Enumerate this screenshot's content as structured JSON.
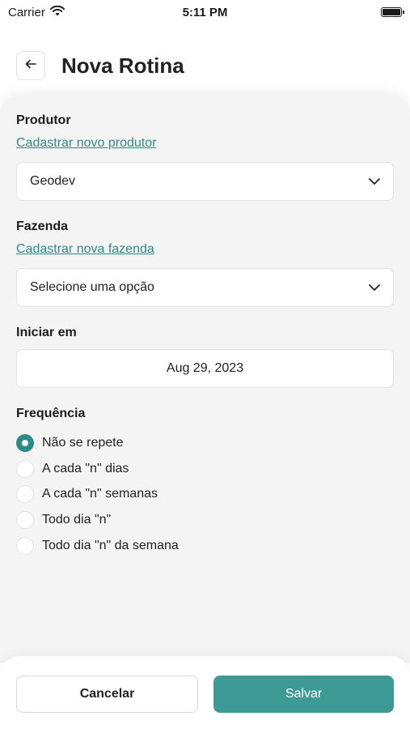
{
  "status_bar": {
    "carrier": "Carrier",
    "time": "5:11 PM"
  },
  "header": {
    "title": "Nova Rotina"
  },
  "form": {
    "produtor": {
      "label": "Produtor",
      "link": "Cadastrar novo produtor",
      "selected": "Geodev"
    },
    "fazenda": {
      "label": "Fazenda",
      "link": "Cadastrar nova fazenda",
      "placeholder": "Selecione uma opção"
    },
    "iniciar_em": {
      "label": "Iniciar em",
      "date": "Aug 29, 2023"
    },
    "frequencia": {
      "label": "Frequência",
      "options": [
        {
          "label": "Não se repete",
          "selected": true
        },
        {
          "label": "A cada \"n\" dias",
          "selected": false
        },
        {
          "label": "A cada \"n\" semanas",
          "selected": false
        },
        {
          "label": "Todo dia \"n\"",
          "selected": false
        },
        {
          "label": "Todo dia \"n\" da semana",
          "selected": false
        }
      ]
    }
  },
  "footer": {
    "cancel_label": "Cancelar",
    "save_label": "Salvar"
  },
  "colors": {
    "accent": "#2b8c86",
    "button_primary": "#3d9a94",
    "background": "#f4f4f4"
  }
}
